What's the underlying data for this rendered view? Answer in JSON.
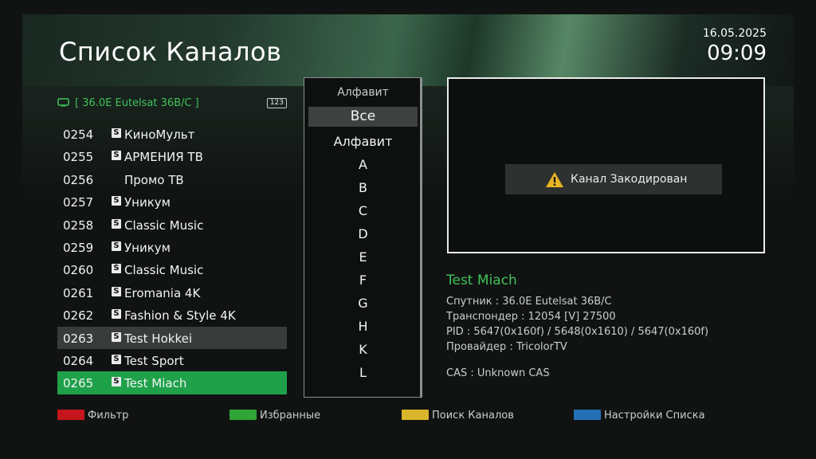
{
  "header": {
    "title": "Список Каналов",
    "date": "16.05.2025",
    "time": "09:09"
  },
  "satellite": {
    "label": "[ 36.0E Eutelsat 36B/C ]",
    "badge": "123",
    "icon": "tv-icon"
  },
  "channels": [
    {
      "num": "0254",
      "name": "КиноМульт",
      "scrambled": true
    },
    {
      "num": "0255",
      "name": "АРМЕНИЯ ТВ",
      "scrambled": true
    },
    {
      "num": "0256",
      "name": "Промо ТВ",
      "scrambled": false
    },
    {
      "num": "0257",
      "name": "Уникум",
      "scrambled": true
    },
    {
      "num": "0258",
      "name": "Classic Music",
      "scrambled": true
    },
    {
      "num": "0259",
      "name": "Уникум",
      "scrambled": true
    },
    {
      "num": "0260",
      "name": "Classic Music",
      "scrambled": true
    },
    {
      "num": "0261",
      "name": "Eromania 4K",
      "scrambled": true
    },
    {
      "num": "0262",
      "name": "Fashion & Style 4K",
      "scrambled": true
    },
    {
      "num": "0263",
      "name": "Test Hokkei",
      "scrambled": true
    },
    {
      "num": "0264",
      "name": "Test Sport",
      "scrambled": true
    },
    {
      "num": "0265",
      "name": "Test Miach",
      "scrambled": true
    }
  ],
  "scramble_glyph": "S",
  "sort_panel": {
    "title": "Алфавит",
    "items": [
      "Все",
      "Алфавит",
      "A",
      "B",
      "C",
      "D",
      "E",
      "F",
      "G",
      "H",
      "K",
      "L"
    ]
  },
  "preview": {
    "message": "Канал Закодирован",
    "icon": "warning-icon"
  },
  "info": {
    "channel_name": "Test Miach",
    "satellite": "Спутник : 36.0E Eutelsat 36B/C",
    "transponder": "Транспондер : 12054 [V] 27500",
    "pid": "PID : 5647(0x160f) / 5648(0x1610) / 5647(0x160f)",
    "provider": "Провайдер : TricolorTV",
    "cas": "CAS : Unknown CAS"
  },
  "legend": [
    {
      "label": "Фильтр",
      "color": "#c4161c"
    },
    {
      "label": "Избранные",
      "color": "#2fa536"
    },
    {
      "label": "Поиск Каналов",
      "color": "#d9b52b"
    },
    {
      "label": "Настройки Списка",
      "color": "#2470b6"
    }
  ],
  "colors": {
    "accent_green": "#3fc25a",
    "active_row": "#1fa14a",
    "selected_row": "#3a3c3c"
  }
}
